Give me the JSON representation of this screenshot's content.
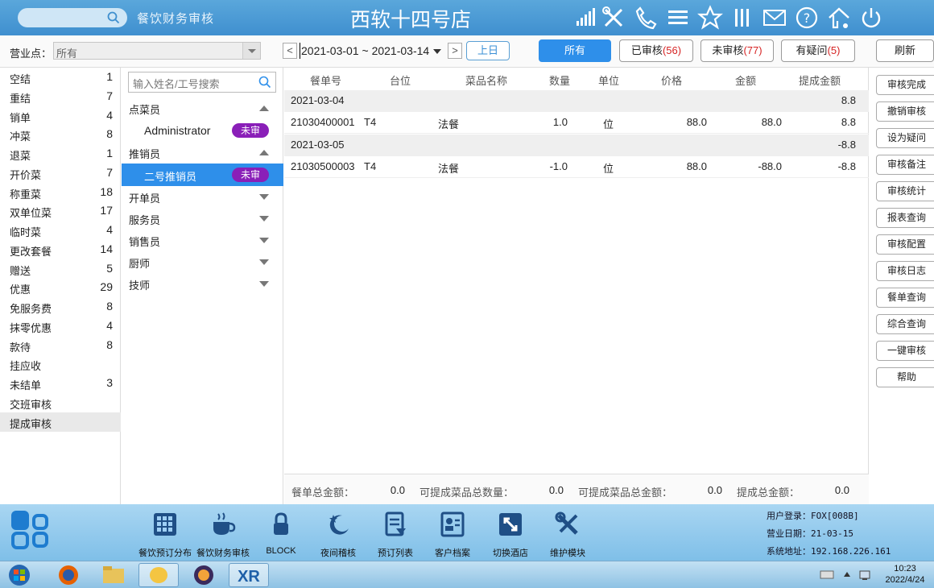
{
  "header": {
    "app_name": "餐饮财务审核",
    "store_title": "西软十四号店"
  },
  "toolbar": {
    "outlet_label": "营业点：",
    "outlet_value": "所有",
    "date_range": "2021-03-01 ~ 2021-03-14",
    "prev_day": "上日",
    "prev_arrow": "<",
    "next_arrow": ">",
    "filters": [
      {
        "label": "所有",
        "count": "",
        "active": true
      },
      {
        "label": "已审核",
        "count": "(56)"
      },
      {
        "label": "未审核",
        "count": "(77)"
      },
      {
        "label": "有疑问",
        "count": "(5)"
      }
    ],
    "refresh": "刷新"
  },
  "categories": [
    {
      "name": "空结",
      "count": "1"
    },
    {
      "name": "重结",
      "count": "7"
    },
    {
      "name": "销单",
      "count": "4"
    },
    {
      "name": "冲菜",
      "count": "8"
    },
    {
      "name": "退菜",
      "count": "1"
    },
    {
      "name": "开价菜",
      "count": "7"
    },
    {
      "name": "称重菜",
      "count": "18"
    },
    {
      "name": "双单位菜",
      "count": "17"
    },
    {
      "name": "临时菜",
      "count": "4"
    },
    {
      "name": "更改套餐",
      "count": "14"
    },
    {
      "name": "赠送",
      "count": "5"
    },
    {
      "name": "优惠",
      "count": "29"
    },
    {
      "name": "免服务费",
      "count": "8"
    },
    {
      "name": "抹零优惠",
      "count": "4"
    },
    {
      "name": "款待",
      "count": "8"
    },
    {
      "name": "挂应收",
      "count": ""
    },
    {
      "name": "未结单",
      "count": "3"
    },
    {
      "name": "交班审核",
      "count": ""
    },
    {
      "name": "提成审核",
      "count": ""
    }
  ],
  "staff": {
    "search_placeholder": "输入姓名/工号搜索",
    "groups": [
      {
        "name": "点菜员",
        "open": true,
        "members": [
          {
            "name": "Administrator",
            "badge": "未审"
          }
        ]
      },
      {
        "name": "推销员",
        "open": true,
        "members": [
          {
            "name": "二号推销员",
            "badge": "未审",
            "selected": true
          }
        ]
      },
      {
        "name": "开单员",
        "open": false,
        "members": []
      },
      {
        "name": "服务员",
        "open": false,
        "members": []
      },
      {
        "name": "销售员",
        "open": false,
        "members": []
      },
      {
        "name": "厨师",
        "open": false,
        "members": []
      },
      {
        "name": "技师",
        "open": false,
        "members": []
      }
    ]
  },
  "table": {
    "columns": [
      "餐单号",
      "台位",
      "菜品名称",
      "数量",
      "单位",
      "价格",
      "金额",
      "提成金额"
    ],
    "groups": [
      {
        "date": "2021-03-04",
        "subtotal": "8.8",
        "rows": [
          {
            "order": "21030400001",
            "table": "T4",
            "dish": "法餐",
            "qty": "1.0",
            "unit": "位",
            "price": "88.0",
            "amount": "88.0",
            "commission": "8.8"
          }
        ]
      },
      {
        "date": "2021-03-05",
        "subtotal": "-8.8",
        "rows": [
          {
            "order": "21030500003",
            "table": "T4",
            "dish": "法餐",
            "qty": "-1.0",
            "unit": "位",
            "price": "88.0",
            "amount": "-88.0",
            "commission": "-8.8"
          }
        ]
      }
    ],
    "totals": [
      {
        "label": "餐单总金额：",
        "value": "0.0"
      },
      {
        "label": "可提成菜品总数量：",
        "value": "0.0"
      },
      {
        "label": "可提成菜品总金额：",
        "value": "0.0"
      },
      {
        "label": "提成总金额：",
        "value": "0.0"
      }
    ]
  },
  "actions": [
    "审核完成",
    "撤销审核",
    "设为疑问",
    "审核备注",
    "审核统计",
    "报表查询",
    "审核配置",
    "审核日志",
    "餐单查询",
    "综合查询",
    "一键审核",
    "帮助"
  ],
  "dock": {
    "items": [
      {
        "label": "餐饮预订分布",
        "icon": "grid-calendar-icon"
      },
      {
        "label": "餐饮财务审核",
        "icon": "coffee-cup-icon"
      },
      {
        "label": "BLOCK",
        "icon": "lock-icon"
      },
      {
        "label": "夜间稽核",
        "icon": "moon-icon"
      },
      {
        "label": "预订列表",
        "icon": "document-list-icon"
      },
      {
        "label": "客户档案",
        "icon": "contact-card-icon"
      },
      {
        "label": "切换酒店",
        "icon": "switch-hotel-icon"
      },
      {
        "label": "维护模块",
        "icon": "tools-icon"
      }
    ],
    "info": [
      {
        "key": "用户登录：",
        "value": "FOX[008B]"
      },
      {
        "key": "营业日期：",
        "value": "21-03-15"
      },
      {
        "key": "系统地址：",
        "value": "192.168.226.161"
      }
    ]
  },
  "taskbar": {
    "time": "10:23",
    "date": "2022/4/24"
  },
  "colors": {
    "title_bar": "#3f8fcf",
    "accent": "#2e8fea",
    "badge": "#8a1fb8",
    "count_red": "#d62424"
  }
}
